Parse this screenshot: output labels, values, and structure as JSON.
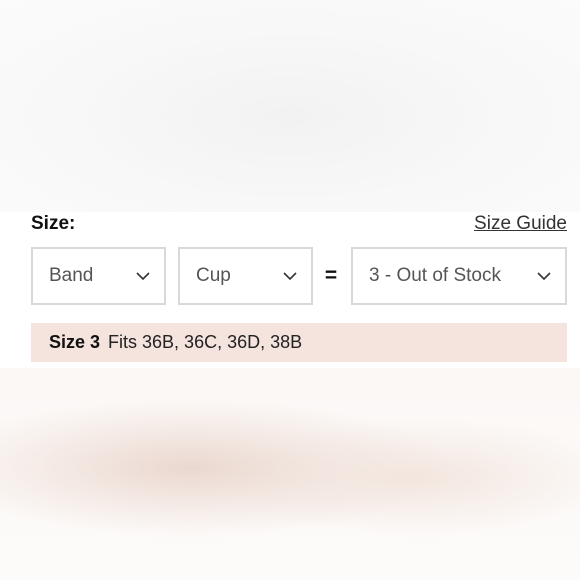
{
  "size_section": {
    "label": "Size:",
    "guide_link": "Size Guide",
    "band_select": {
      "value": "Band",
      "icon": "chevron-down-icon"
    },
    "cup_select": {
      "value": "Cup",
      "icon": "chevron-down-icon"
    },
    "equals": "=",
    "result_select": {
      "value": "3 - Out of Stock",
      "icon": "chevron-down-icon"
    },
    "fit": {
      "size": "Size 3",
      "text": "Fits 36B, 36C, 36D, 38B"
    }
  },
  "colors": {
    "fit_banner_bg": "#f5e3de",
    "select_border": "#d9d9d9"
  }
}
